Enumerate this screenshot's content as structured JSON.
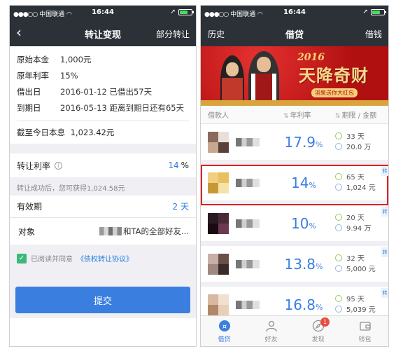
{
  "status_bar": {
    "carrier": "中国联通",
    "time": "16:44"
  },
  "left_screen": {
    "nav": {
      "title": "转让变现",
      "right": "部分转让"
    },
    "info": [
      {
        "label": "原始本金",
        "value": "1,000元"
      },
      {
        "label": "原年利率",
        "value": "15%"
      },
      {
        "label": "借出日",
        "value": "2016-01-12 已借出57天"
      },
      {
        "label": "到期日",
        "value": "2016-05-13 距离到期日还有65天"
      }
    ],
    "interest": {
      "label": "截至今日本息",
      "value": "1,023.42元"
    },
    "transfer_rate": {
      "label": "转让利率",
      "value": "14",
      "unit": "%"
    },
    "hint": "转让成功后，您可获得1,024.58元",
    "validity": {
      "label": "有效期",
      "value": "2 天"
    },
    "target": {
      "label": "对象",
      "value": "和TA的全部好友..."
    },
    "agreement": {
      "prefix": "已阅读并同意",
      "link": "《债权转让协议》",
      "checked": true
    },
    "submit_label": "提交"
  },
  "right_screen": {
    "nav": {
      "title": "借贷",
      "left": "历史",
      "right": "借钱"
    },
    "banner": {
      "year": "2016",
      "slogan": "天降奇财",
      "sub": "羽泉送你大红包"
    },
    "list_header": {
      "borrower": "借款人",
      "rate": "年利率",
      "term_amount": "期限 / 金额"
    },
    "ribbon_text": "转",
    "loans": [
      {
        "rate": "17.9",
        "term": "33 天",
        "amount": "20.0 万",
        "highlight": false,
        "avatar": [
          "#8a6a5a",
          "#e8e0d8",
          "#c8a890",
          "#5a4038"
        ],
        "ribbon": false
      },
      {
        "rate": "14",
        "term": "65 天",
        "amount": "1,024 元",
        "highlight": true,
        "avatar": [
          "#f0d080",
          "#e8c060",
          "#c89838",
          "#f5e2a8"
        ],
        "ribbon": true
      },
      {
        "rate": "10",
        "term": "20 天",
        "amount": "9.94 万",
        "highlight": false,
        "avatar": [
          "#2a1a22",
          "#4a2a38",
          "#1a0a12",
          "#6a3a50"
        ],
        "ribbon": true
      },
      {
        "rate": "13.8",
        "term": "32 天",
        "amount": "5,000 元",
        "highlight": false,
        "avatar": [
          "#c8b0a8",
          "#6a5048",
          "#a08880",
          "#3a2a28"
        ],
        "ribbon": true
      },
      {
        "rate": "16.8",
        "term": "95 天",
        "amount": "5,039 元",
        "highlight": false,
        "avatar": [
          "#d8b8a0",
          "#f0e0d0",
          "#b08868",
          "#e8d0b8"
        ],
        "ribbon": true
      }
    ],
    "tabs": [
      {
        "label": "借贷",
        "icon": "loan-icon",
        "active": true
      },
      {
        "label": "好友",
        "icon": "friends-icon",
        "active": false
      },
      {
        "label": "发现",
        "icon": "compass-icon",
        "active": false,
        "badge": "1"
      },
      {
        "label": "钱包",
        "icon": "wallet-icon",
        "active": false
      }
    ]
  }
}
